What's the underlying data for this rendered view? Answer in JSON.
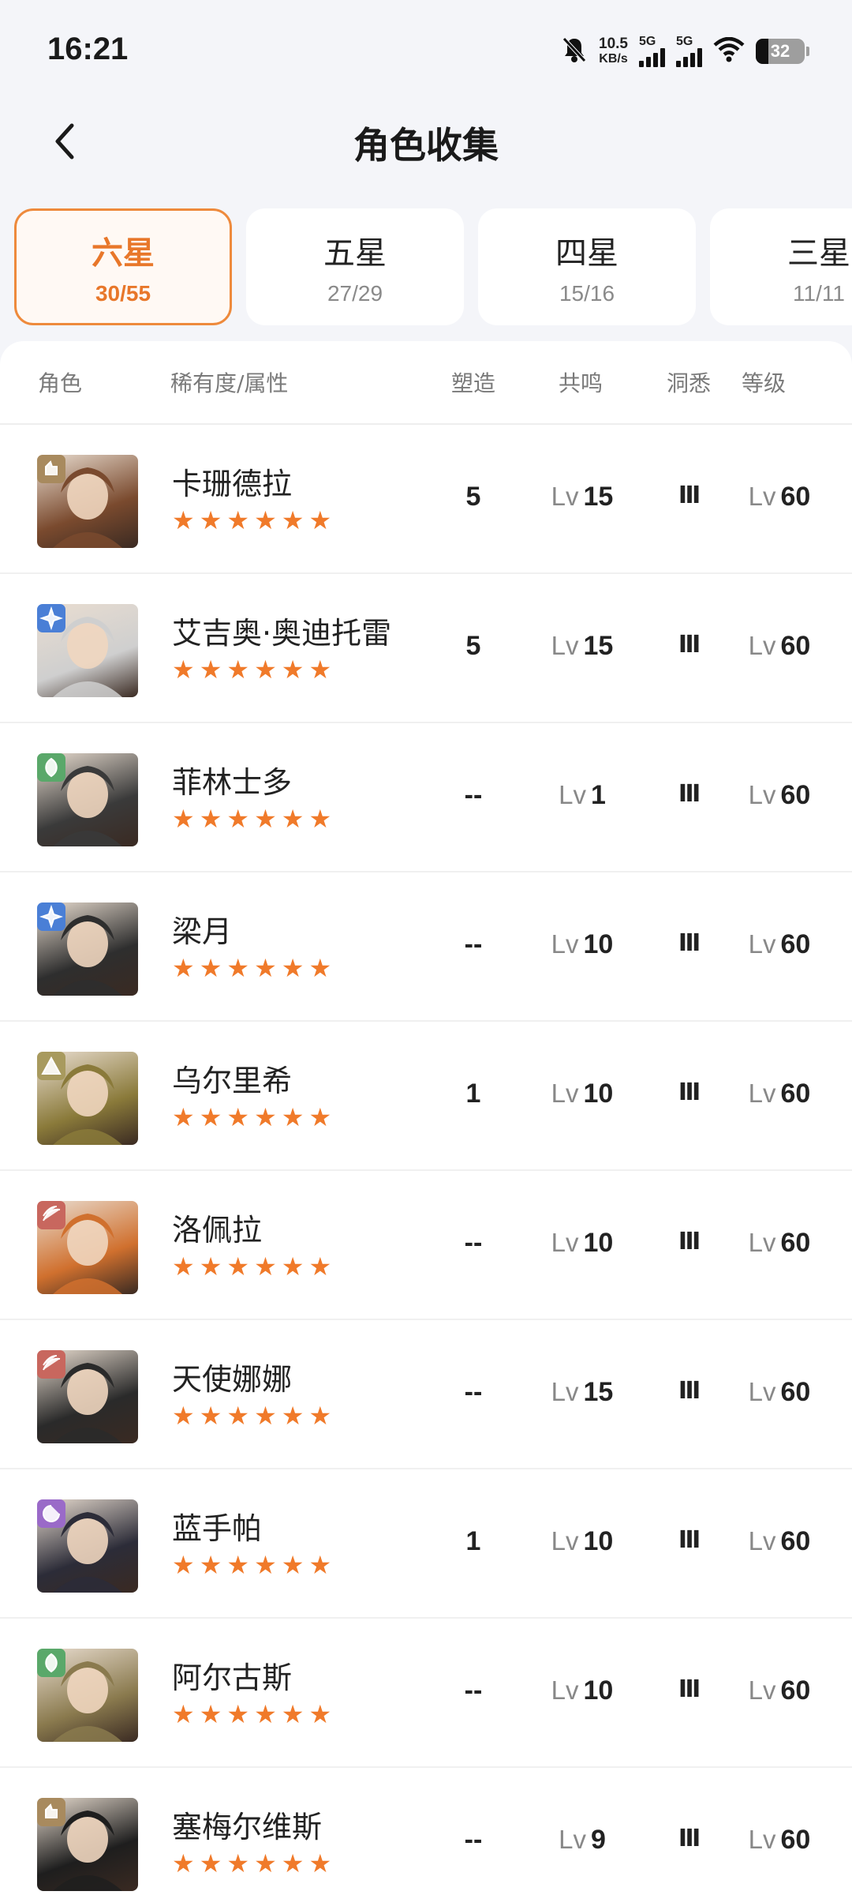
{
  "status_bar": {
    "time": "16:21",
    "net_speed": "10.5",
    "net_unit": "KB/s",
    "sig1": "5G",
    "sig2": "5G",
    "battery": "32"
  },
  "header": {
    "title": "角色收集"
  },
  "tabs": [
    {
      "name": "六星",
      "count": "30/55",
      "active": true
    },
    {
      "name": "五星",
      "count": "27/29",
      "active": false
    },
    {
      "name": "四星",
      "count": "15/16",
      "active": false
    },
    {
      "name": "三星",
      "count": "11/11",
      "active": false
    }
  ],
  "table": {
    "headers": {
      "character": "角色",
      "rarity": "稀有度/属性",
      "shape": "塑造",
      "resonance": "共鸣",
      "insight": "洞悉",
      "level": "等级"
    },
    "lv_prefix": "Lv",
    "stars": "★★★★★★",
    "rows": [
      {
        "name": "卡珊德拉",
        "shape": "5",
        "resonance": "15",
        "insight": "Ⅲ",
        "level": "60",
        "attr_color": "#a88a5e",
        "portrait": "#7a4a2e"
      },
      {
        "name": "艾吉奥·奥迪托雷",
        "shape": "5",
        "resonance": "15",
        "insight": "Ⅲ",
        "level": "60",
        "attr_color": "#4a7fd6",
        "portrait": "#cfcfcf"
      },
      {
        "name": "菲林士多",
        "shape": "--",
        "resonance": "1",
        "insight": "Ⅲ",
        "level": "60",
        "attr_color": "#5aa86a",
        "portrait": "#3a3a3a"
      },
      {
        "name": "梁月",
        "shape": "--",
        "resonance": "10",
        "insight": "Ⅲ",
        "level": "60",
        "attr_color": "#4a7fd6",
        "portrait": "#2e2e2e"
      },
      {
        "name": "乌尔里希",
        "shape": "1",
        "resonance": "10",
        "insight": "Ⅲ",
        "level": "60",
        "attr_color": "#a89a5e",
        "portrait": "#8a7a3a"
      },
      {
        "name": "洛佩拉",
        "shape": "--",
        "resonance": "10",
        "insight": "Ⅲ",
        "level": "60",
        "attr_color": "#c8675e",
        "portrait": "#d0702e"
      },
      {
        "name": "天使娜娜",
        "shape": "--",
        "resonance": "15",
        "insight": "Ⅲ",
        "level": "60",
        "attr_color": "#c8675e",
        "portrait": "#2a2a2a"
      },
      {
        "name": "蓝手帕",
        "shape": "1",
        "resonance": "10",
        "insight": "Ⅲ",
        "level": "60",
        "attr_color": "#9a6ac8",
        "portrait": "#2c2c38"
      },
      {
        "name": "阿尔古斯",
        "shape": "--",
        "resonance": "10",
        "insight": "Ⅲ",
        "level": "60",
        "attr_color": "#5aa86a",
        "portrait": "#8a7a4e"
      },
      {
        "name": "塞梅尔维斯",
        "shape": "--",
        "resonance": "9",
        "insight": "Ⅲ",
        "level": "60",
        "attr_color": "#a88a5e",
        "portrait": "#1e1e1e"
      }
    ]
  }
}
